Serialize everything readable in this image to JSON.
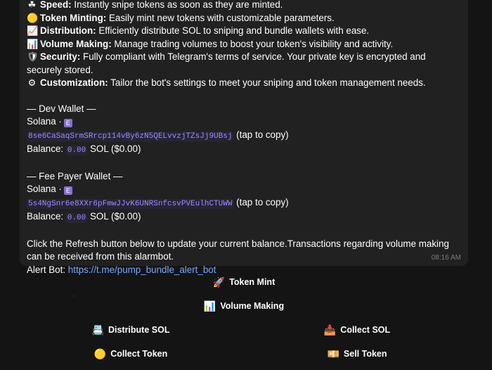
{
  "message": {
    "features": [
      {
        "icon": "clover-icon",
        "glyph": "☘",
        "label": "Speed:",
        "text": " Instantly snipe tokens as soon as they are minted."
      },
      {
        "icon": "yellow-circle-icon",
        "glyph": "🟡",
        "label": "Token Minting:",
        "text": " Easily mint new tokens with customizable parameters."
      },
      {
        "icon": "chart-up-icon",
        "glyph": "📈",
        "label": "Distribution:",
        "text": " Efficiently distribute SOL to sniping and bundle wallets with ease."
      },
      {
        "icon": "bar-chart-icon",
        "glyph": "📊",
        "label": "Volume Making:",
        "text": " Manage trading volumes to boost your token's visibility and activity."
      },
      {
        "icon": "shield-icon",
        "glyph": "🛡",
        "label": "Security:",
        "text": " Fully compliant with Telegram's terms of service. Your private key is encrypted and securely stored."
      },
      {
        "icon": "gear-icon",
        "glyph": "⚙",
        "label": "Customization:",
        "text": " Tailor the bot's settings to meet your sniping and token management needs."
      }
    ],
    "dev_wallet": {
      "header": "— Dev Wallet —",
      "chain": "Solana ·",
      "badge": "E",
      "address": "8se6CaSaqSrmSRrcp114vBy6zN5QELvvzjTZsJj9UBsj",
      "copy_hint": " (tap to copy)",
      "balance_label": "Balance: ",
      "balance_value": "0.00",
      "balance_suffix": " SOL ($0.00)"
    },
    "fee_wallet": {
      "header": "— Fee Payer Wallet —",
      "chain": "Solana ·",
      "badge": "E",
      "address": "5s4NgSnr6e8XXr6pFmwJJvK6UNRSnfcsvPVEulhCTUWW",
      "copy_hint": " (tap to copy)",
      "balance_label": "Balance: ",
      "balance_value": "0.00",
      "balance_suffix": " SOL ($0.00)"
    },
    "footer_text": "Click the Refresh button below to update your current balance.Transactions regarding volume making can be received from this alarmbot.",
    "alert_label": "Alert Bot: ",
    "alert_link": "https://t.me/pump_bundle_alert_bot",
    "time": "08:16 AM"
  },
  "keyboard": {
    "token_mint": {
      "icon": "rocket-icon",
      "glyph": "🚀",
      "label": "Token Mint"
    },
    "volume_making": {
      "icon": "bar-chart-icon",
      "glyph": "📊",
      "label": "Volume Making"
    },
    "distribute_sol": {
      "icon": "cash-register-icon",
      "glyph": "📇",
      "label": "Distribute SOL"
    },
    "collect_sol": {
      "icon": "inbox-tray-icon",
      "glyph": "📥",
      "label": "Collect SOL"
    },
    "collect_token": {
      "icon": "yellow-circle-icon",
      "glyph": "🟡",
      "label": "Collect Token"
    },
    "sell_token": {
      "icon": "money-icon",
      "glyph": "💴",
      "label": "Sell Token"
    }
  }
}
